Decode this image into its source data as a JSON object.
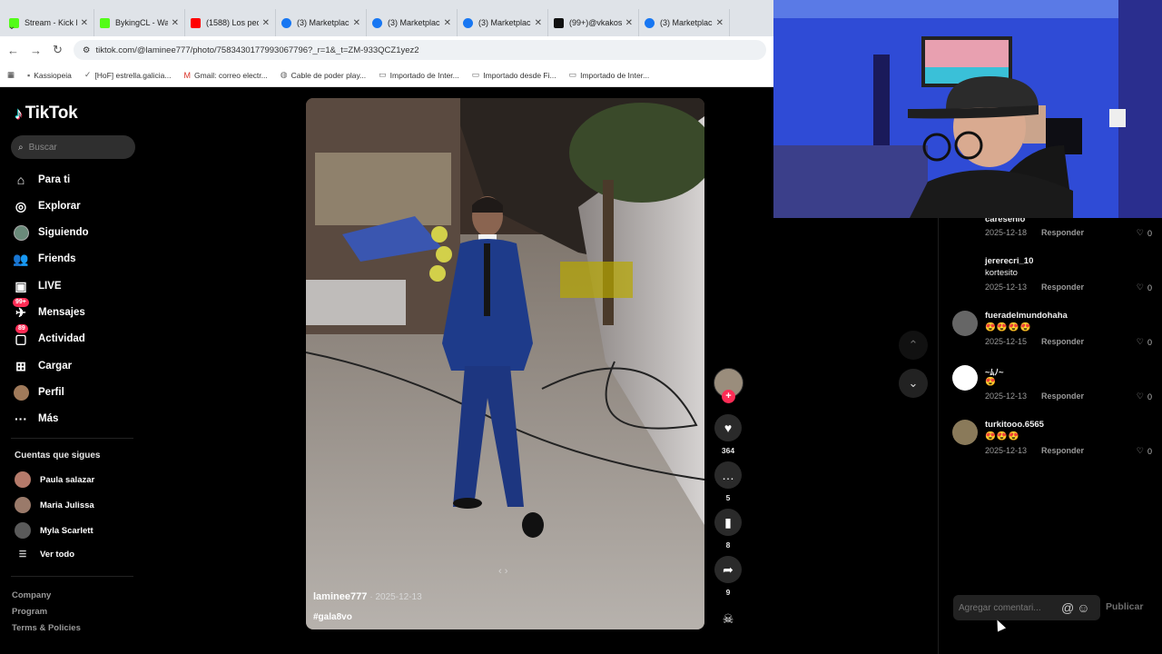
{
  "browser": {
    "tabs": [
      {
        "title": "Stream - Kick D",
        "color": "#53fc18"
      },
      {
        "title": "BykingCL - Wa",
        "color": "#53fc18"
      },
      {
        "title": "(1588) Los pec",
        "color": "#ff0000"
      },
      {
        "title": "(3) Marketplac",
        "color": "#1877f2"
      },
      {
        "title": "(3) Marketplac",
        "color": "#1877f2"
      },
      {
        "title": "(3) Marketplac",
        "color": "#1877f2"
      },
      {
        "title": "(99+)@vkakos",
        "color": "#111111"
      },
      {
        "title": "(3) Marketplac",
        "color": "#1877f2"
      }
    ],
    "url": "tiktok.com/@laminee777/photo/7583430177993067796?_r=1&_t=ZM-933QCZ1yez2",
    "bookmarks": [
      "Kassiopeia",
      "[HoF] estrella.galicia...",
      "Gmail: correo electr...",
      "Cable de poder play...",
      "Importado de Inter...",
      "Importado desde Fi...",
      "Importado de Inter..."
    ]
  },
  "sidebar": {
    "logo": "TikTok",
    "search_placeholder": "Buscar",
    "nav": [
      {
        "label": "Para ti",
        "icon": "home-icon"
      },
      {
        "label": "Explorar",
        "icon": "compass-icon"
      },
      {
        "label": "Siguiendo",
        "icon": "following-icon"
      },
      {
        "label": "Friends",
        "icon": "friends-icon"
      },
      {
        "label": "LIVE",
        "icon": "live-icon"
      },
      {
        "label": "Mensajes",
        "icon": "messages-icon",
        "badge": "99+"
      },
      {
        "label": "Actividad",
        "icon": "activity-icon",
        "badge": "89"
      },
      {
        "label": "Cargar",
        "icon": "upload-icon"
      },
      {
        "label": "Perfil",
        "icon": "profile-icon"
      },
      {
        "label": "Más",
        "icon": "more-icon"
      }
    ],
    "following_title": "Cuentas que sigues",
    "following": [
      "Paula salazar",
      "Maria Julissa",
      "Myla Scarlett"
    ],
    "see_all": "Ver todo",
    "footer": [
      "Company",
      "Program",
      "Terms & Policies"
    ]
  },
  "post": {
    "username": "laminee777",
    "date": "· 2025-12-13",
    "hashtag": "#gala8vo",
    "pager": "‹   ›"
  },
  "actions": {
    "likes": "364",
    "comments": "5",
    "saves": "8",
    "shares": "9",
    "follow_plus": "+"
  },
  "comments": {
    "items": [
      {
        "user": "caresenio",
        "text": "",
        "date": "2025-12-18",
        "likes": "0",
        "avatar": "#3a3a3a"
      },
      {
        "user": "jererecri_10",
        "text": "kortesito",
        "date": "2025-12-13",
        "likes": "0",
        "avatar": "#000000"
      },
      {
        "user": "fueradelmundohaha",
        "text": "😍😍😍😍",
        "date": "2025-12-15",
        "likes": "0",
        "avatar": "#666666"
      },
      {
        "user": "~ﾑﾉ~",
        "text": "😍",
        "date": "2025-12-13",
        "likes": "0",
        "avatar": "#ffffff"
      },
      {
        "user": "turkitooo.6565",
        "text": "😍😍😍",
        "date": "2025-12-13",
        "likes": "0",
        "avatar": "#8a7a5a"
      }
    ],
    "reply_label": "Responder",
    "input_placeholder": "Agregar comentari...",
    "at_symbol": "@",
    "emoji_symbol": "☺",
    "publish": "Publicar"
  }
}
